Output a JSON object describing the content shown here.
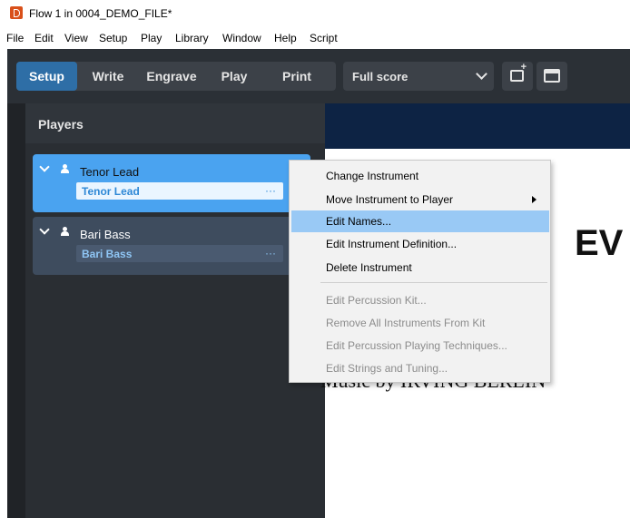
{
  "window": {
    "title": "Flow 1 in 0004_DEMO_FILE*"
  },
  "menubar": {
    "items": [
      "File",
      "Edit",
      "View",
      "Setup",
      "Play",
      "Library",
      "Window",
      "Help",
      "Script"
    ]
  },
  "toolbar": {
    "tabs": [
      {
        "label": "Setup",
        "active": true
      },
      {
        "label": "Write",
        "active": false
      },
      {
        "label": "Engrave",
        "active": false
      },
      {
        "label": "Play",
        "active": false
      },
      {
        "label": "Print",
        "active": false
      }
    ],
    "layout_select": {
      "value": "Full score"
    }
  },
  "players_panel": {
    "title": "Players",
    "players": [
      {
        "name": "Tenor Lead",
        "instrument": "Tenor Lead",
        "selected": true
      },
      {
        "name": "Bari Bass",
        "instrument": "Bari Bass",
        "selected": false
      }
    ],
    "more_glyph": "···"
  },
  "score": {
    "title": "EV",
    "credit": "Music by IRVING BERLIN"
  },
  "context_menu": {
    "items": [
      {
        "label": "Change Instrument",
        "enabled": true,
        "highlighted": false,
        "submenu": false
      },
      {
        "label": "Move Instrument to Player",
        "enabled": true,
        "highlighted": false,
        "submenu": true
      },
      {
        "label": "Edit Names...",
        "enabled": true,
        "highlighted": true,
        "submenu": false
      },
      {
        "label": "Edit Instrument Definition...",
        "enabled": true,
        "highlighted": false,
        "submenu": false
      },
      {
        "label": "Delete Instrument",
        "enabled": true,
        "highlighted": false,
        "submenu": false
      },
      {
        "label": "Edit Percussion Kit...",
        "enabled": false,
        "highlighted": false,
        "submenu": false
      },
      {
        "label": "Remove All Instruments From Kit",
        "enabled": false,
        "highlighted": false,
        "submenu": false
      },
      {
        "label": "Edit Percussion Playing Techniques...",
        "enabled": false,
        "highlighted": false,
        "submenu": false
      },
      {
        "label": "Edit Strings and Tuning...",
        "enabled": false,
        "highlighted": false,
        "submenu": false
      }
    ]
  },
  "colors": {
    "toolbar_bg": "#2b3036",
    "active_tab": "#2e6ea6",
    "selected_player": "#4aa3f0",
    "menu_highlight": "#99c9f5",
    "score_header": "#0d2344"
  }
}
